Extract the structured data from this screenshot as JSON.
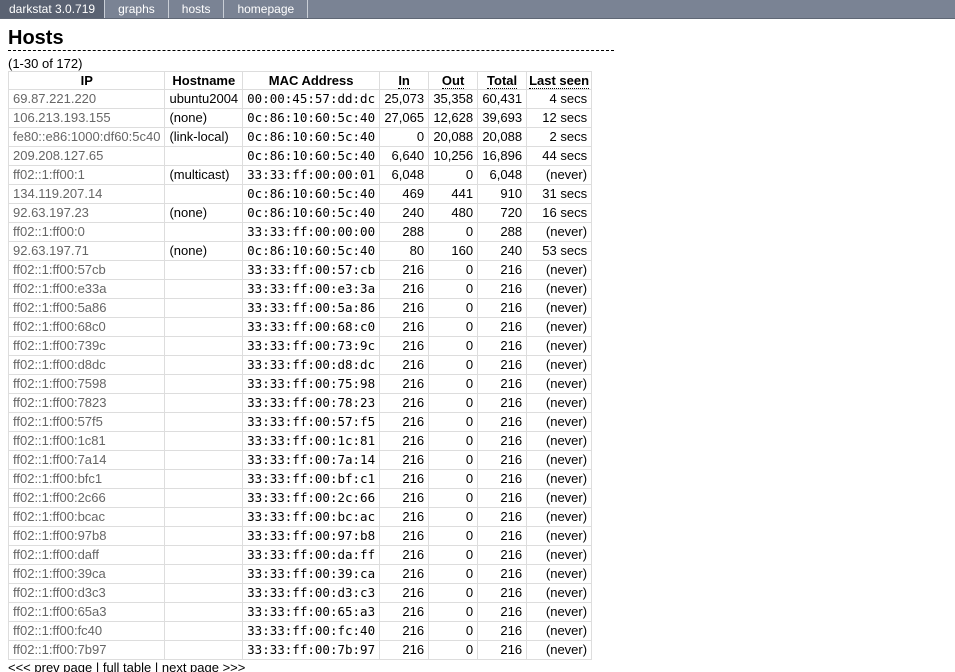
{
  "nav": {
    "brand": "darkstat 3.0.719",
    "links": [
      "graphs",
      "hosts",
      "homepage"
    ]
  },
  "page": {
    "title": "Hosts",
    "count_text": "(1-30 of 172)"
  },
  "table": {
    "headers": [
      "IP",
      "Hostname",
      "MAC Address",
      "In",
      "Out",
      "Total",
      "Last seen"
    ],
    "rows": [
      [
        "69.87.221.220",
        "ubuntu2004",
        "00:00:45:57:dd:dc",
        "25,073",
        "35,358",
        "60,431",
        "4 secs"
      ],
      [
        "106.213.193.155",
        "(none)",
        "0c:86:10:60:5c:40",
        "27,065",
        "12,628",
        "39,693",
        "12 secs"
      ],
      [
        "fe80::e86:1000:df60:5c40",
        "(link-local)",
        "0c:86:10:60:5c:40",
        "0",
        "20,088",
        "20,088",
        "2 secs"
      ],
      [
        "209.208.127.65",
        "",
        "0c:86:10:60:5c:40",
        "6,640",
        "10,256",
        "16,896",
        "44 secs"
      ],
      [
        "ff02::1:ff00:1",
        "(multicast)",
        "33:33:ff:00:00:01",
        "6,048",
        "0",
        "6,048",
        "(never)"
      ],
      [
        "134.119.207.14",
        "",
        "0c:86:10:60:5c:40",
        "469",
        "441",
        "910",
        "31 secs"
      ],
      [
        "92.63.197.23",
        "(none)",
        "0c:86:10:60:5c:40",
        "240",
        "480",
        "720",
        "16 secs"
      ],
      [
        "ff02::1:ff00:0",
        "",
        "33:33:ff:00:00:00",
        "288",
        "0",
        "288",
        "(never)"
      ],
      [
        "92.63.197.71",
        "(none)",
        "0c:86:10:60:5c:40",
        "80",
        "160",
        "240",
        "53 secs"
      ],
      [
        "ff02::1:ff00:57cb",
        "",
        "33:33:ff:00:57:cb",
        "216",
        "0",
        "216",
        "(never)"
      ],
      [
        "ff02::1:ff00:e33a",
        "",
        "33:33:ff:00:e3:3a",
        "216",
        "0",
        "216",
        "(never)"
      ],
      [
        "ff02::1:ff00:5a86",
        "",
        "33:33:ff:00:5a:86",
        "216",
        "0",
        "216",
        "(never)"
      ],
      [
        "ff02::1:ff00:68c0",
        "",
        "33:33:ff:00:68:c0",
        "216",
        "0",
        "216",
        "(never)"
      ],
      [
        "ff02::1:ff00:739c",
        "",
        "33:33:ff:00:73:9c",
        "216",
        "0",
        "216",
        "(never)"
      ],
      [
        "ff02::1:ff00:d8dc",
        "",
        "33:33:ff:00:d8:dc",
        "216",
        "0",
        "216",
        "(never)"
      ],
      [
        "ff02::1:ff00:7598",
        "",
        "33:33:ff:00:75:98",
        "216",
        "0",
        "216",
        "(never)"
      ],
      [
        "ff02::1:ff00:7823",
        "",
        "33:33:ff:00:78:23",
        "216",
        "0",
        "216",
        "(never)"
      ],
      [
        "ff02::1:ff00:57f5",
        "",
        "33:33:ff:00:57:f5",
        "216",
        "0",
        "216",
        "(never)"
      ],
      [
        "ff02::1:ff00:1c81",
        "",
        "33:33:ff:00:1c:81",
        "216",
        "0",
        "216",
        "(never)"
      ],
      [
        "ff02::1:ff00:7a14",
        "",
        "33:33:ff:00:7a:14",
        "216",
        "0",
        "216",
        "(never)"
      ],
      [
        "ff02::1:ff00:bfc1",
        "",
        "33:33:ff:00:bf:c1",
        "216",
        "0",
        "216",
        "(never)"
      ],
      [
        "ff02::1:ff00:2c66",
        "",
        "33:33:ff:00:2c:66",
        "216",
        "0",
        "216",
        "(never)"
      ],
      [
        "ff02::1:ff00:bcac",
        "",
        "33:33:ff:00:bc:ac",
        "216",
        "0",
        "216",
        "(never)"
      ],
      [
        "ff02::1:ff00:97b8",
        "",
        "33:33:ff:00:97:b8",
        "216",
        "0",
        "216",
        "(never)"
      ],
      [
        "ff02::1:ff00:daff",
        "",
        "33:33:ff:00:da:ff",
        "216",
        "0",
        "216",
        "(never)"
      ],
      [
        "ff02::1:ff00:39ca",
        "",
        "33:33:ff:00:39:ca",
        "216",
        "0",
        "216",
        "(never)"
      ],
      [
        "ff02::1:ff00:d3c3",
        "",
        "33:33:ff:00:d3:c3",
        "216",
        "0",
        "216",
        "(never)"
      ],
      [
        "ff02::1:ff00:65a3",
        "",
        "33:33:ff:00:65:a3",
        "216",
        "0",
        "216",
        "(never)"
      ],
      [
        "ff02::1:ff00:fc40",
        "",
        "33:33:ff:00:fc:40",
        "216",
        "0",
        "216",
        "(never)"
      ],
      [
        "ff02::1:ff00:7b97",
        "",
        "33:33:ff:00:7b:97",
        "216",
        "0",
        "216",
        "(never)"
      ]
    ]
  },
  "pager": {
    "prev": "<<< prev page",
    "sep1": " | ",
    "full": "full table",
    "sep2": " | ",
    "next": "next page >>>"
  },
  "colors": {
    "nav_bg": "#7a8394",
    "brand_bg": "#5a6272",
    "border": "#dddddd",
    "ip_text": "#666666"
  }
}
